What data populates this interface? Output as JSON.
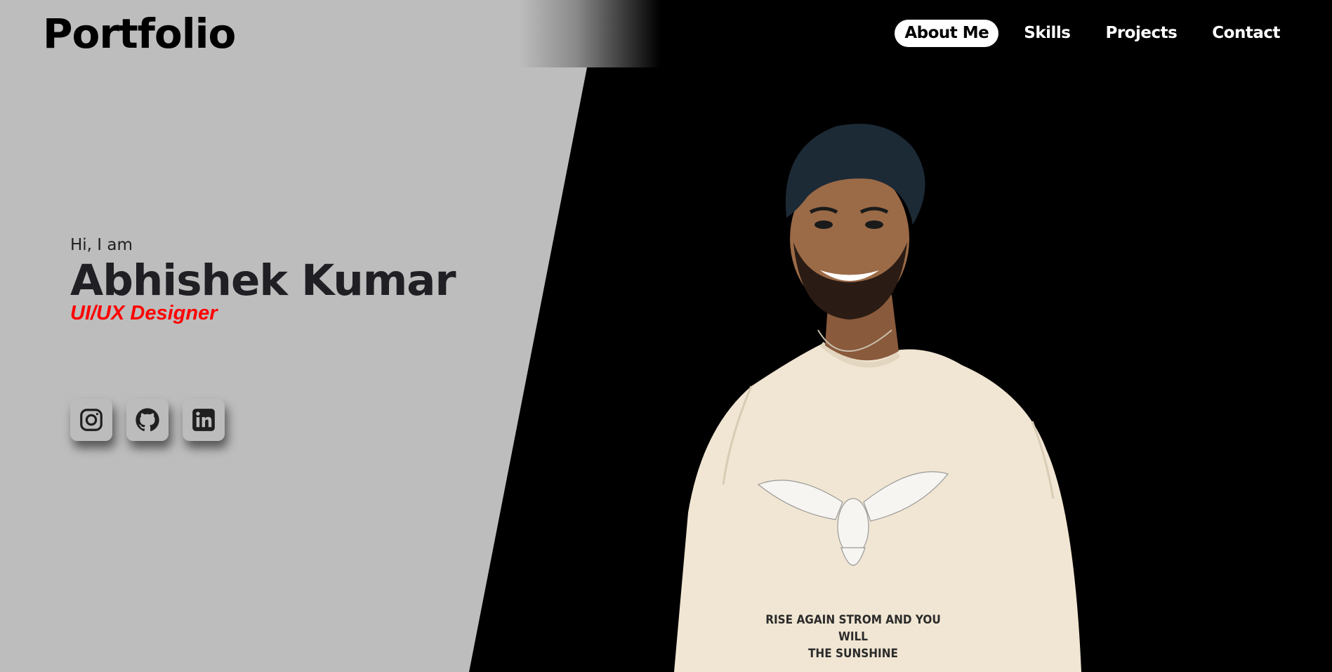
{
  "header": {
    "logo": "Portfolio",
    "nav": [
      {
        "label": "About Me",
        "active": true
      },
      {
        "label": "Skills",
        "active": false
      },
      {
        "label": "Projects",
        "active": false
      },
      {
        "label": "Contact",
        "active": false
      }
    ]
  },
  "hero": {
    "greeting": "Hi, I am",
    "name": "Abhishek Kumar",
    "role": "UI/UX Designer",
    "role_color": "#ff0000"
  },
  "socials": [
    {
      "icon": "instagram-icon"
    },
    {
      "icon": "github-icon"
    },
    {
      "icon": "linkedin-icon"
    }
  ],
  "portrait": {
    "shirt_line1": "RISE AGAIN STROM AND YOU WILL",
    "shirt_line2": "THE SUNSHINE"
  },
  "colors": {
    "left_panel": "#bdbdbd",
    "right_panel": "#000000",
    "nav_active_bg": "#ffffff"
  }
}
